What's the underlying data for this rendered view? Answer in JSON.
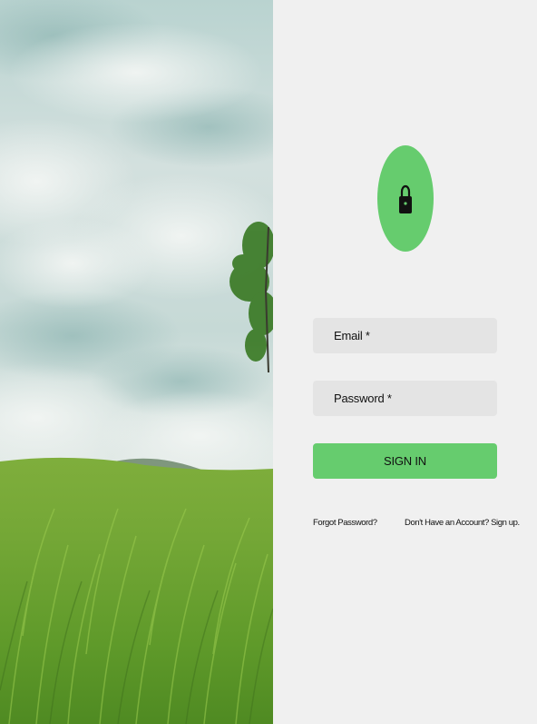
{
  "colors": {
    "accent": "#66cc6e",
    "panel_background": "#f0f0f0",
    "field_background": "#e4e4e4"
  },
  "hero": {
    "image_name": "grass-field-with-cloudy-sky-and-tree-image"
  },
  "login": {
    "icon": "lock-icon",
    "email_label": "Email *",
    "password_label": "Password *",
    "submit_label": "SIGN IN",
    "forgot_link": "Forgot Password?",
    "signup_link": "Don't Have an Account? Sign up."
  }
}
